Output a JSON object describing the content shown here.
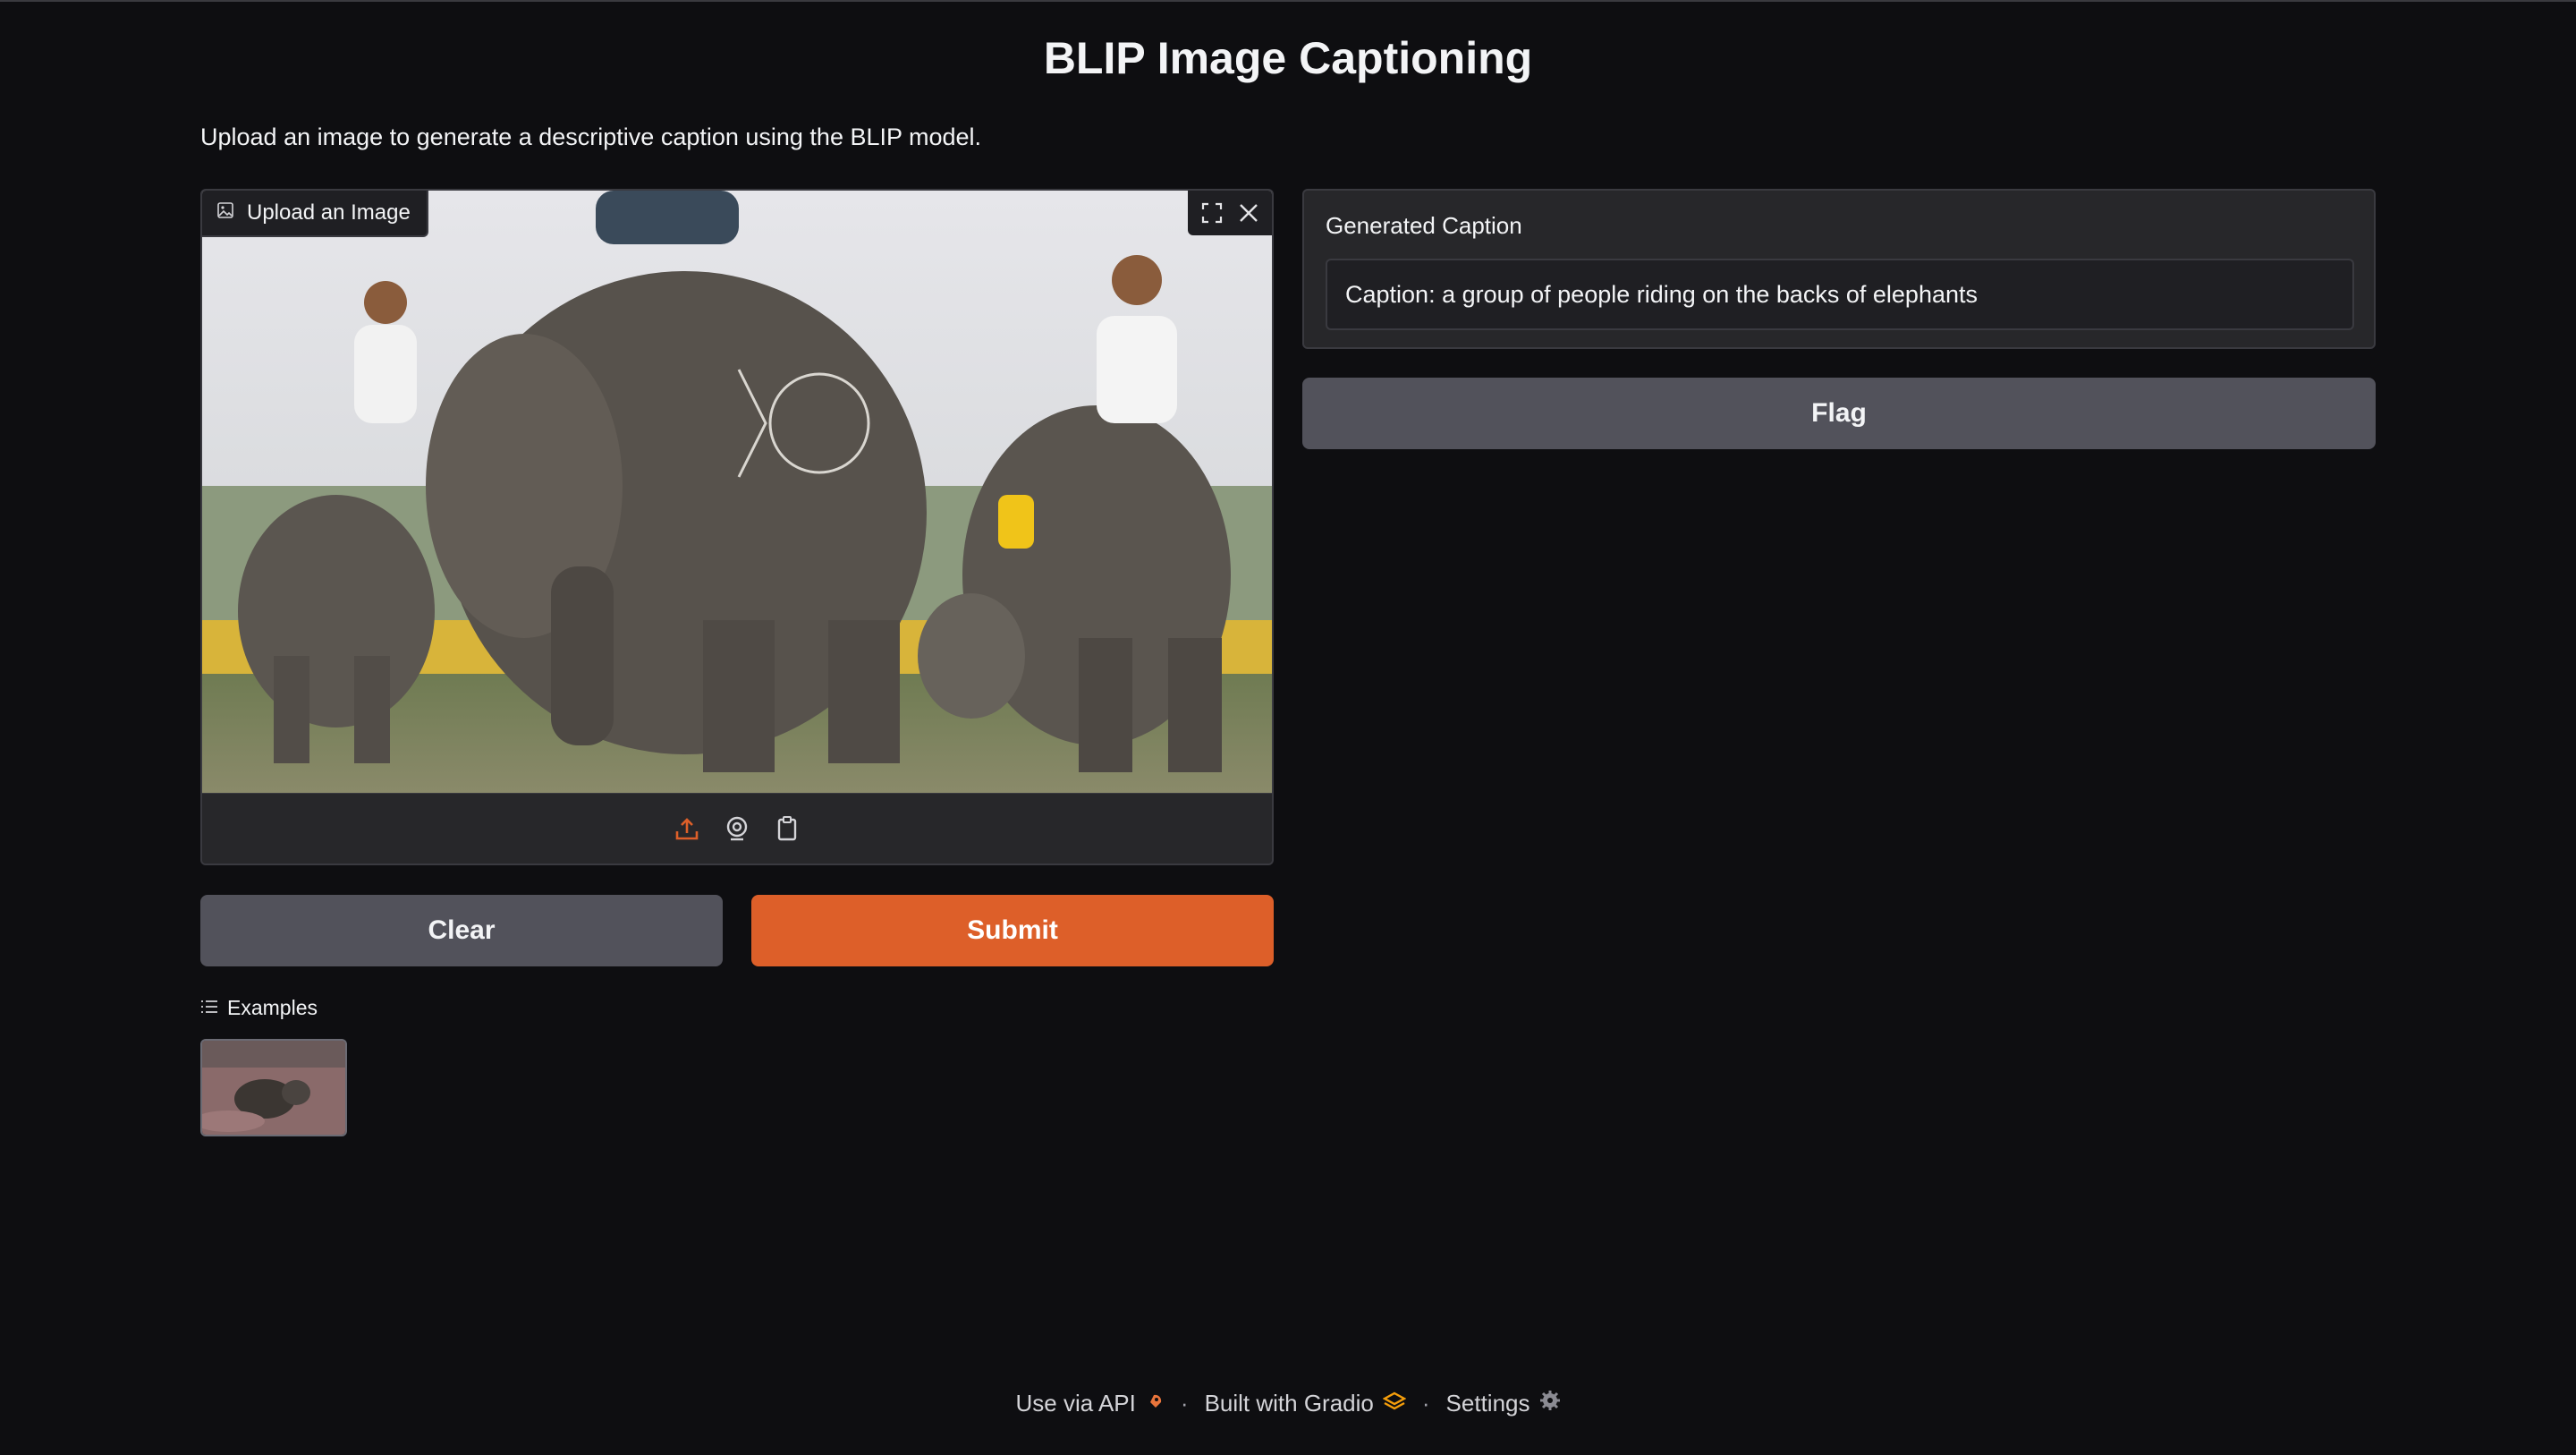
{
  "page": {
    "title": "BLIP Image Captioning",
    "description": "Upload an image to generate a descriptive caption using the BLIP model."
  },
  "image_input": {
    "label": "Upload an Image",
    "controls": [
      "fullscreen-icon",
      "close-icon"
    ],
    "toolbar": [
      "upload-icon",
      "webcam-icon",
      "clipboard-icon"
    ],
    "accent_color": "#dd5f29"
  },
  "actions": {
    "clear_label": "Clear",
    "submit_label": "Submit",
    "flag_label": "Flag"
  },
  "examples": {
    "label": "Examples"
  },
  "output": {
    "label": "Generated Caption",
    "value": "Caption: a group of people riding on the backs of elephants"
  },
  "footer": {
    "api_label": "Use via API",
    "gradio_label": "Built with Gradio",
    "settings_label": "Settings",
    "separator": "·"
  },
  "colors": {
    "background": "#0e0e11",
    "panel": "#27272a",
    "secondary_button": "#52525b",
    "primary_button": "#dd5f29"
  }
}
